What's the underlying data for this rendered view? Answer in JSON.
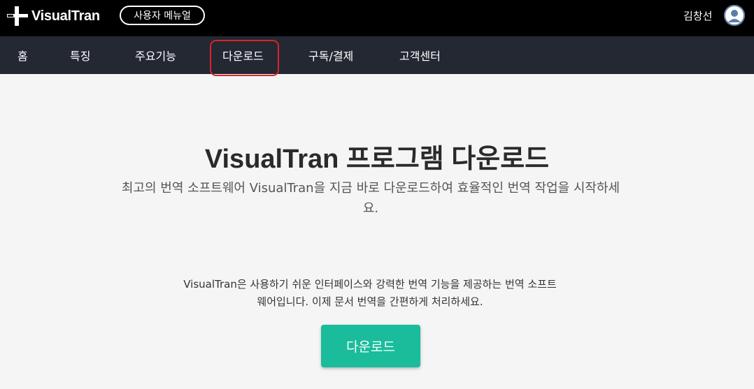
{
  "header": {
    "logo_text": "VisualTran",
    "user_menu_label": "사용자 메뉴얼",
    "user_name": "김창선",
    "avatar_icon": "user-avatar-icon"
  },
  "nav": {
    "items": [
      {
        "label": "홈"
      },
      {
        "label": "특징"
      },
      {
        "label": "주요기능"
      },
      {
        "label": "다운로드"
      },
      {
        "label": "구독/결제"
      },
      {
        "label": "고객센터"
      }
    ],
    "highlighted": "다운로드",
    "highlight_color": "#d9232a"
  },
  "hero": {
    "title": "VisualTran 프로그램 다운로드",
    "subtitle_line1": "최고의 번역 소프트웨어 VisualTran을 지금 바로 다운로드하여 효율적인 번역 작업을 시작하세",
    "subtitle_line2": "요."
  },
  "description": {
    "line1": "VisualTran은 사용하기 쉬운 인터페이스와 강력한 번역 기능을 제공하는 번역 소프트",
    "line2": "웨어입니다. 이제 문서 번역을 간편하게 처리하세요."
  },
  "download_button": {
    "label": "다운로드",
    "color": "#1abc9c"
  },
  "colors": {
    "topbar": "#000000",
    "navbar": "#232833",
    "page_bg": "#f5f5f5"
  }
}
